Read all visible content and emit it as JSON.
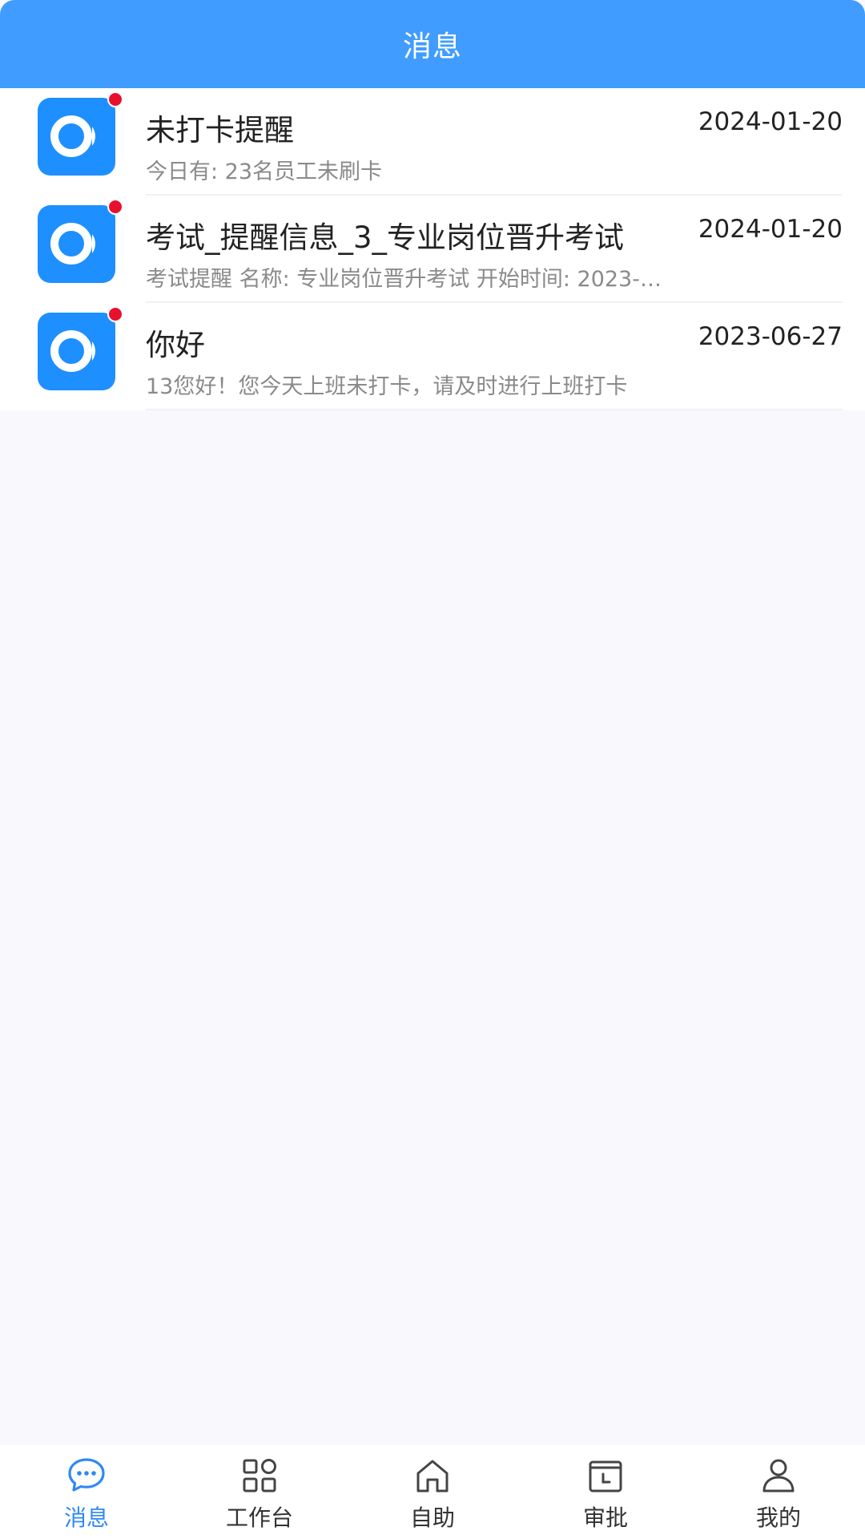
{
  "header": {
    "title": "消息"
  },
  "colors": {
    "header_bg": "#409cff",
    "accent": "#2f88f4",
    "badge": "#e8112d",
    "avatar_bg": "#1e8fff"
  },
  "messages": [
    {
      "title": "未打卡提醒",
      "date": "2024-01-20",
      "preview": "今日有: 23名员工未刷卡",
      "unread": true,
      "icon": "app-logo-icon"
    },
    {
      "title": "考试_提醒信息_3_专业岗位晋升考试",
      "date": "2024-01-20",
      "preview": "考试提醒 名称: 专业岗位晋升考试 开始时间: 2023-…",
      "unread": true,
      "icon": "app-logo-icon"
    },
    {
      "title": "你好",
      "date": "2023-06-27",
      "preview": "13您好！您今天上班未打卡，请及时进行上班打卡",
      "unread": true,
      "icon": "app-logo-icon"
    }
  ],
  "tabbar": {
    "active": 0,
    "tabs": [
      {
        "label": "消息",
        "icon": "chat-bubble-icon"
      },
      {
        "label": "工作台",
        "icon": "grid-apps-icon"
      },
      {
        "label": "自助",
        "icon": "home-icon"
      },
      {
        "label": "审批",
        "icon": "calendar-clock-icon"
      },
      {
        "label": "我的",
        "icon": "user-icon"
      }
    ]
  }
}
